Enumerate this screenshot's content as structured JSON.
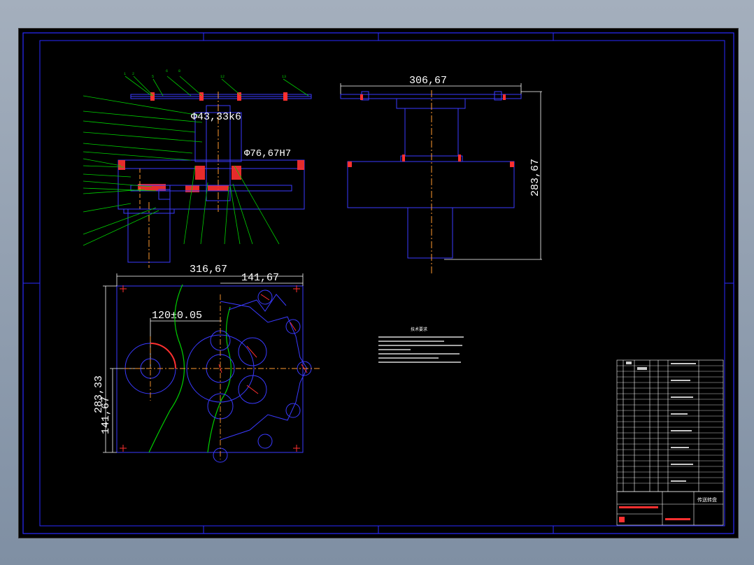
{
  "drawing": {
    "title": "CAD assembly drawing - rotary feeder",
    "colors": {
      "background": "#000000",
      "frame": "#2020ff",
      "outline": "#3a3aff",
      "dimension": "#ffffff",
      "leader": "#00e000",
      "centerline": "#ff9a30",
      "hatch": "#ff2020"
    }
  },
  "dimensions": {
    "top_diameter": "Φ43,33k6",
    "mid_diameter": "Φ76,67H7",
    "side_width": "306,67",
    "side_height": "283,67",
    "plan_width": "316,67",
    "plan_half_width": "141,67",
    "center_distance": "120±0.05",
    "plan_height": "283,33",
    "plan_half_height": "141,67"
  },
  "notes": {
    "heading": "技术要求"
  },
  "title_block": {
    "drawing_name": "传送转盘"
  }
}
